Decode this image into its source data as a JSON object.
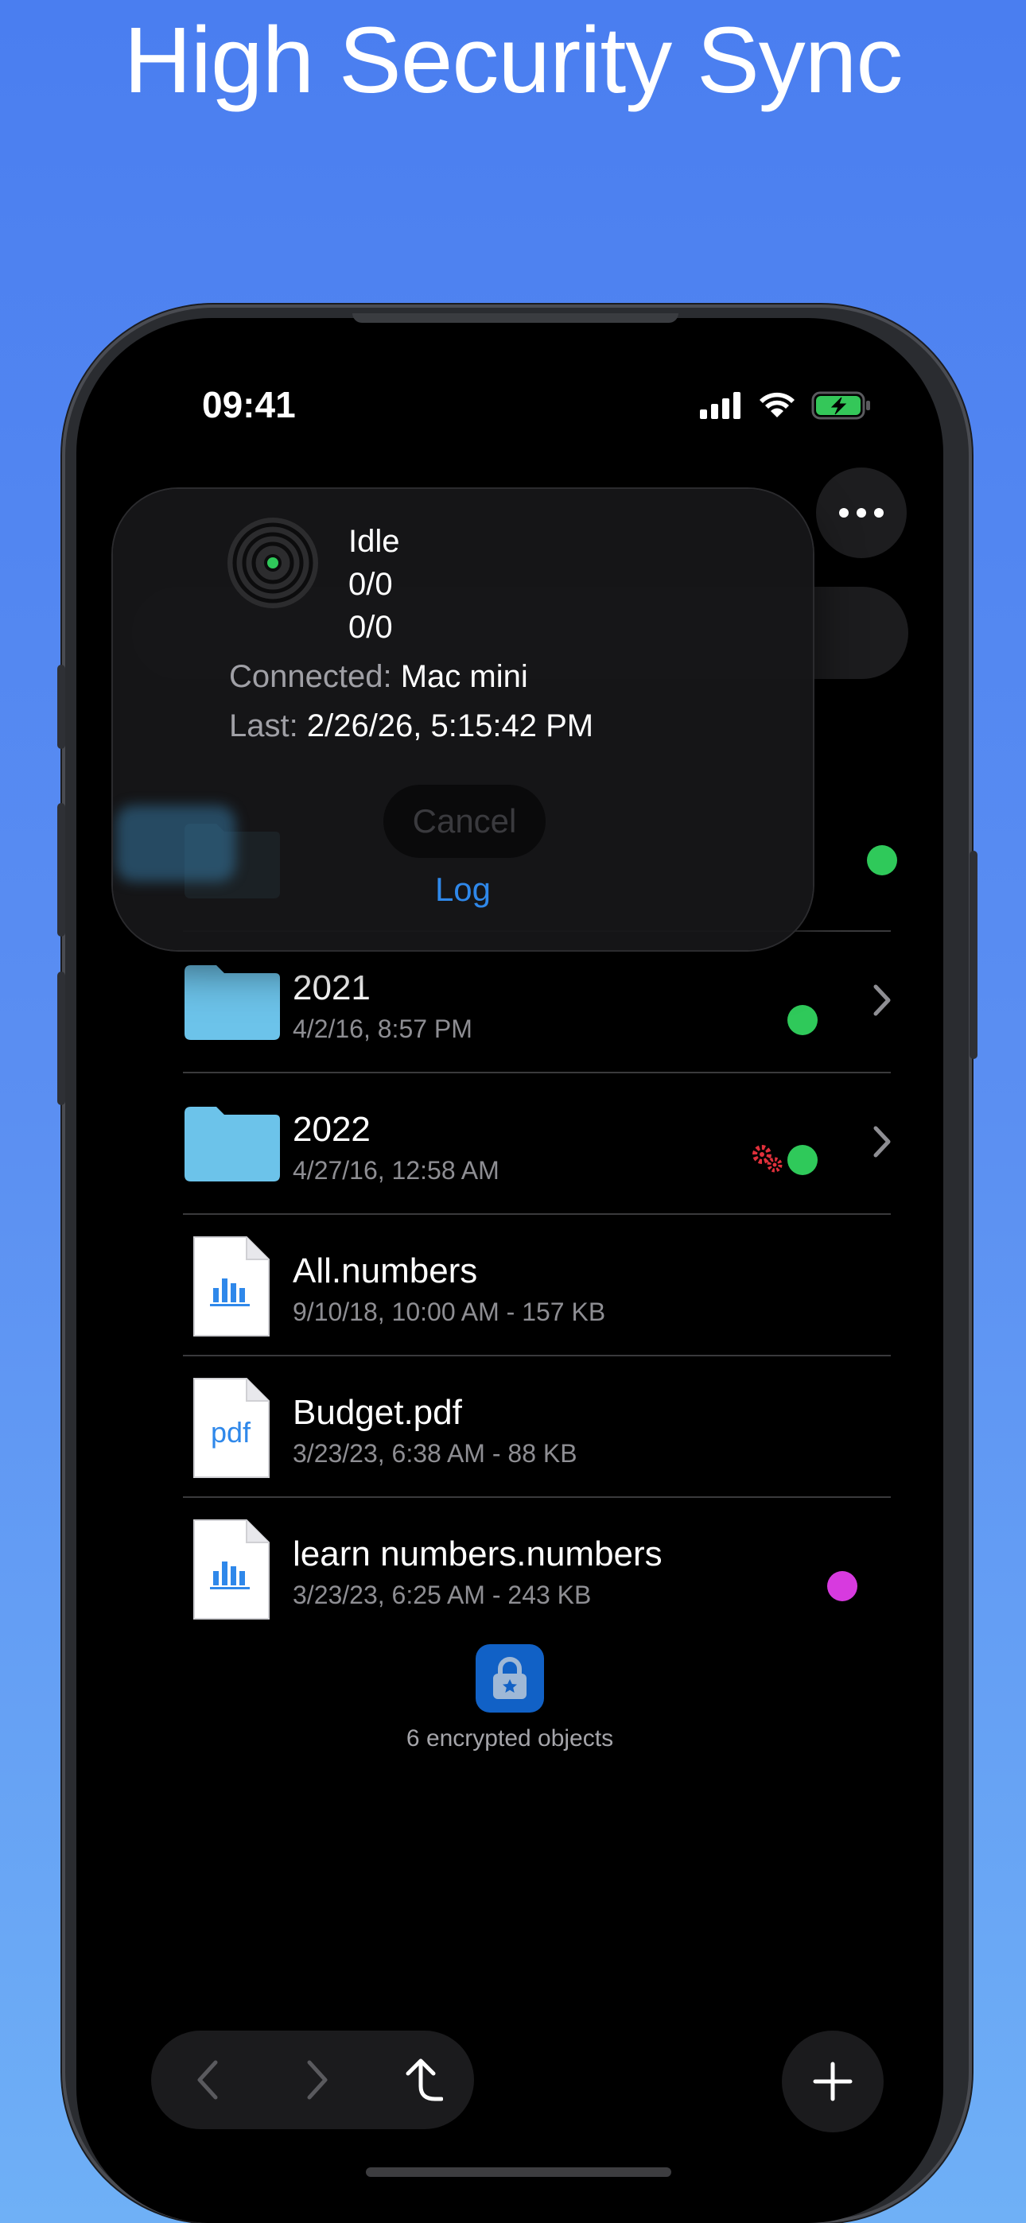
{
  "headline": "High Security Sync",
  "status_bar": {
    "time": "09:41"
  },
  "sync_popup": {
    "state": "Idle",
    "count_1": "0/0",
    "count_2": "0/0",
    "connected_label": "Connected:",
    "connected_value": "Mac mini",
    "last_label": "Last:",
    "last_value": "2/26/26, 5:15:42 PM",
    "cancel_label": "Cancel",
    "log_label": "Log"
  },
  "files": [
    {
      "name": "",
      "meta": "",
      "kind": "folder",
      "status": [
        "green"
      ]
    },
    {
      "name": "2021",
      "meta": "4/2/16, 8:57 PM",
      "kind": "folder",
      "status": [
        "green"
      ]
    },
    {
      "name": "2022",
      "meta": "4/27/16, 12:58 AM",
      "kind": "folder",
      "status": [
        "gears-red",
        "green"
      ]
    },
    {
      "name": "All.numbers",
      "meta": "9/10/18, 10:00 AM - 157 KB",
      "kind": "numbers",
      "status": []
    },
    {
      "name": "Budget.pdf",
      "meta": "3/23/23, 6:38 AM - 88 KB",
      "kind": "pdf",
      "pdf_label": "pdf",
      "status": []
    },
    {
      "name": "learn numbers.numbers",
      "meta": "3/23/23, 6:25 AM - 243 KB",
      "kind": "numbers",
      "status": [
        "magenta"
      ]
    }
  ],
  "footer": {
    "encrypted_text": "6 encrypted objects"
  },
  "colors": {
    "status_green": "#2fc95a",
    "status_magenta": "#d73adf",
    "gears_red": "#e0303b",
    "accent_blue": "#2f88ea",
    "folder_blue": "#6cc3ea"
  },
  "icons": {
    "toolbar": [
      "more-icon"
    ],
    "nav": [
      "back-icon",
      "forward-icon",
      "parent-folder-icon"
    ],
    "action": [
      "plus-icon"
    ]
  }
}
